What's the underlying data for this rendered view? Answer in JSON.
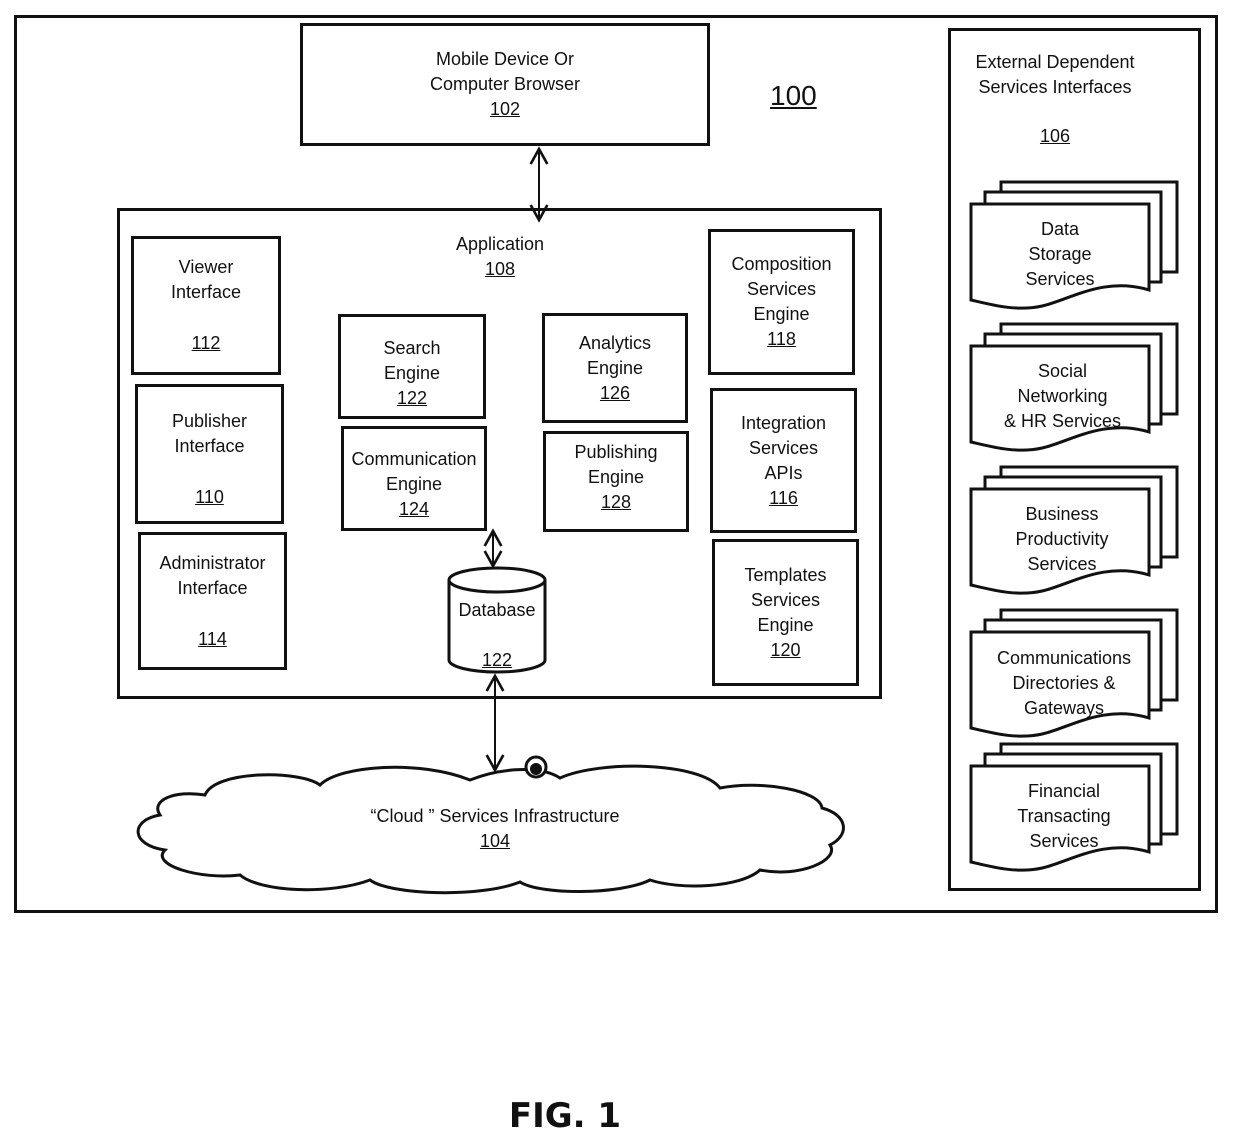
{
  "diagram": {
    "system_ref": "100",
    "figure_label": "FIG. 1",
    "client": {
      "lines": [
        "Mobile Device Or",
        "Computer Browser"
      ],
      "ref": "102"
    },
    "application": {
      "title": "Application",
      "ref": "108",
      "components": {
        "viewer_interface": {
          "lines": [
            "Viewer",
            "Interface"
          ],
          "ref": "112"
        },
        "publisher_interface": {
          "lines": [
            "Publisher",
            "Interface"
          ],
          "ref": "110"
        },
        "administrator_interface": {
          "lines": [
            "Administrator",
            "Interface"
          ],
          "ref": "114"
        },
        "search_engine": {
          "lines": [
            "Search",
            "Engine"
          ],
          "ref": "122"
        },
        "communication_engine": {
          "lines": [
            "Communication",
            "Engine"
          ],
          "ref": "124"
        },
        "analytics_engine": {
          "lines": [
            "Analytics",
            "Engine"
          ],
          "ref": "126"
        },
        "publishing_engine": {
          "lines": [
            "Publishing",
            "Engine"
          ],
          "ref": "128"
        },
        "composition_services_engine": {
          "lines": [
            "Composition",
            "Services",
            "Engine"
          ],
          "ref": "118"
        },
        "integration_services_apis": {
          "lines": [
            "Integration",
            "Services",
            "APIs"
          ],
          "ref": "116"
        },
        "templates_services_engine": {
          "lines": [
            "Templates",
            "Services",
            "Engine"
          ],
          "ref": "120"
        },
        "database": {
          "lines": [
            "Database"
          ],
          "ref": "122"
        }
      }
    },
    "cloud": {
      "lines": [
        "“Cloud ” Services Infrastructure"
      ],
      "ref": "104"
    },
    "external": {
      "title_lines": [
        "External Dependent",
        "Services Interfaces"
      ],
      "ref": "106",
      "services": [
        {
          "lines": [
            "Data",
            "Storage",
            "Services"
          ]
        },
        {
          "lines": [
            "Social",
            "Networking",
            "& HR Services"
          ]
        },
        {
          "lines": [
            "Business",
            "Productivity",
            "Services"
          ]
        },
        {
          "lines": [
            "Communications",
            "Directories &",
            "Gateways"
          ]
        },
        {
          "lines": [
            "Financial",
            "Transacting",
            "Services"
          ]
        }
      ]
    }
  }
}
